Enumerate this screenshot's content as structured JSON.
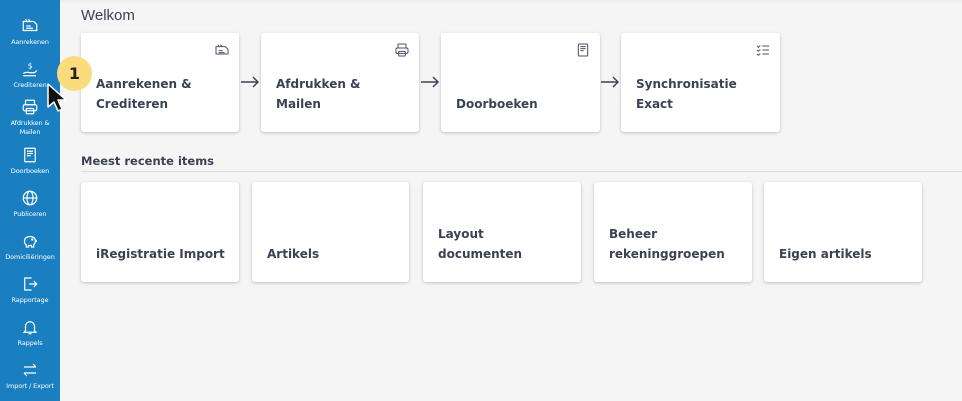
{
  "page_title": "Welkom",
  "sidebar": {
    "items": [
      {
        "label": "Aanrekenen",
        "icon": "invoice-icon"
      },
      {
        "label": "Crediteren",
        "icon": "money-hand-icon"
      },
      {
        "label": "Afdrukken & Mailen",
        "icon": "printer-icon"
      },
      {
        "label": "Doorboeken",
        "icon": "book-icon"
      },
      {
        "label": "Publiceren",
        "icon": "globe-icon"
      },
      {
        "label": "Domiciliëringen",
        "icon": "piggy-bank-icon"
      },
      {
        "label": "Rapportage",
        "icon": "export-icon"
      },
      {
        "label": "Rappels",
        "icon": "bell-icon"
      },
      {
        "label": "Import / Export",
        "icon": "swap-arrows-icon"
      }
    ]
  },
  "workflow": [
    {
      "label": "Aanrekenen & Crediteren",
      "icon": "invoice-icon"
    },
    {
      "label": "Afdrukken & Mailen",
      "icon": "printer-icon"
    },
    {
      "label": "Doorboeken",
      "icon": "book-icon"
    },
    {
      "label": "Synchronisatie Exact",
      "icon": "checklist-icon"
    }
  ],
  "recent": {
    "title": "Meest recente items",
    "items": [
      {
        "label": "iRegistratie Import"
      },
      {
        "label": "Artikels"
      },
      {
        "label": "Layout documenten"
      },
      {
        "label": "Beheer rekeninggroepen"
      },
      {
        "label": "Eigen artikels"
      }
    ]
  },
  "annotation": {
    "step": "1"
  },
  "colors": {
    "sidebar": "#1a7fc0",
    "badge": "#fbdc7c",
    "text": "#3b4255",
    "background": "#f5f5f6"
  }
}
